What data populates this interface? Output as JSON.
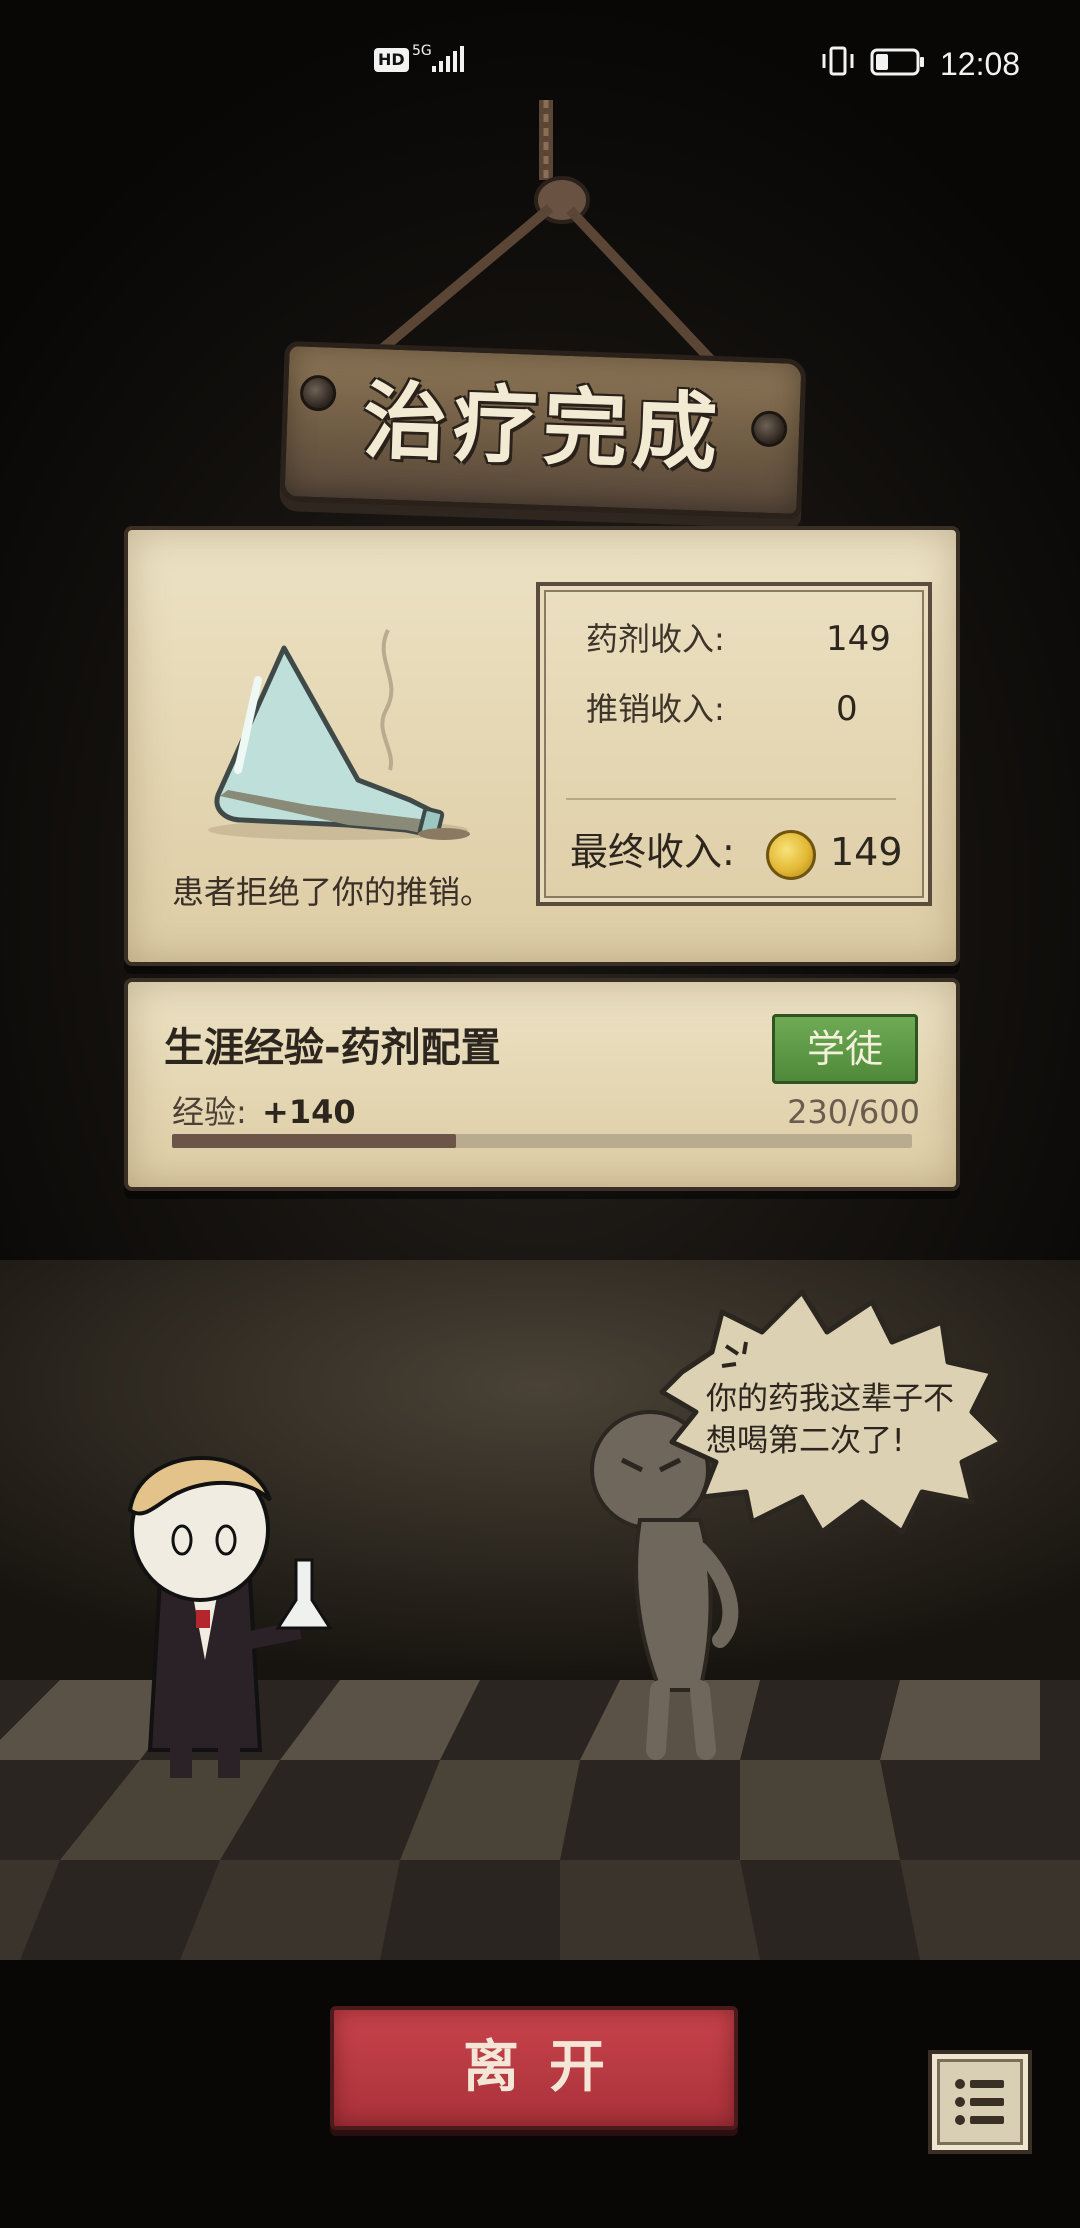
{
  "status_bar": {
    "hd": "HD",
    "network": "5G",
    "time": "12:08",
    "icons": [
      "signal-icon",
      "vibrate-icon",
      "battery-icon"
    ]
  },
  "title": "治疗完成",
  "result": {
    "message": "患者拒绝了你的推销。",
    "potion_income_label": "药剂收入:",
    "potion_income_value": "149",
    "sales_income_label": "推销收入:",
    "sales_income_value": "0",
    "final_income_label": "最终收入:",
    "final_income_value": "149",
    "icons": [
      "spilled-flask-icon",
      "gold-coin-icon"
    ]
  },
  "career": {
    "title": "生涯经验-药剂配置",
    "rank": "学徒",
    "exp_label": "经验:",
    "exp_gain": "+140",
    "exp_current": 230,
    "exp_max": 600,
    "exp_text": "230/600"
  },
  "dialogue": {
    "speech": "你的药我这辈子不想喝第二次了!"
  },
  "actions": {
    "leave_label": "离开",
    "menu_icon": "list-menu-icon"
  },
  "colors": {
    "leave_button": "#b7373f",
    "rank_badge": "#5c9645",
    "parchment": "#e6d9b6",
    "exp_fill": "#6c5448"
  }
}
